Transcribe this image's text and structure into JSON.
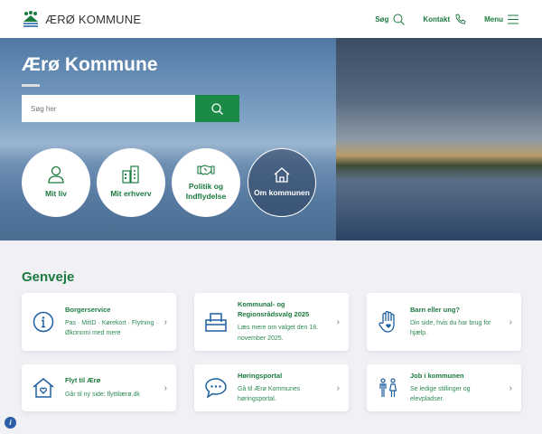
{
  "header": {
    "logo_text": "ÆRØ KOMMUNE",
    "nav": [
      {
        "label": "Søg",
        "icon": "search-icon"
      },
      {
        "label": "Kontakt",
        "icon": "phone-icon"
      },
      {
        "label": "Menu",
        "icon": "menu-icon"
      }
    ]
  },
  "hero": {
    "title": "Ærø Kommune",
    "search_placeholder": "Søg her",
    "circles": [
      {
        "label": "Mit liv",
        "icon": "person-icon"
      },
      {
        "label": "Mit erhverv",
        "icon": "buildings-icon"
      },
      {
        "label": "Politik og Indflydelse",
        "icon": "handshake-icon"
      },
      {
        "label": "Om kommunen",
        "icon": "house-icon"
      }
    ]
  },
  "genveje": {
    "title": "Genveje",
    "cards": [
      {
        "title": "Borgerservice",
        "desc": "Pas · MitID · Kørekort · Flytning · Økonomi med mere",
        "icon": "info-icon"
      },
      {
        "title": "Kommunal- og Regionsrådsvalg 2025",
        "desc": "Læs mere om valget den 18. november 2025.",
        "icon": "ballot-box-icon"
      },
      {
        "title": "Barn eller ung?",
        "desc": "Din side, hvis du har brug for hjælp.",
        "icon": "hand-heart-icon"
      },
      {
        "title": "Flyt til Ærø",
        "desc": "Går til ny side: flyttilærø.dk",
        "icon": "house-heart-icon"
      },
      {
        "title": "Høringsportal",
        "desc": "Gå til Ærø Kommunes høringsportal.",
        "icon": "chat-icon"
      },
      {
        "title": "Job i kommunen",
        "desc": "Se ledige stillinger og elevpladser.",
        "icon": "people-icon"
      }
    ]
  },
  "colors": {
    "brand": "#1b7a3e",
    "icon_blue": "#1d5fa0"
  }
}
